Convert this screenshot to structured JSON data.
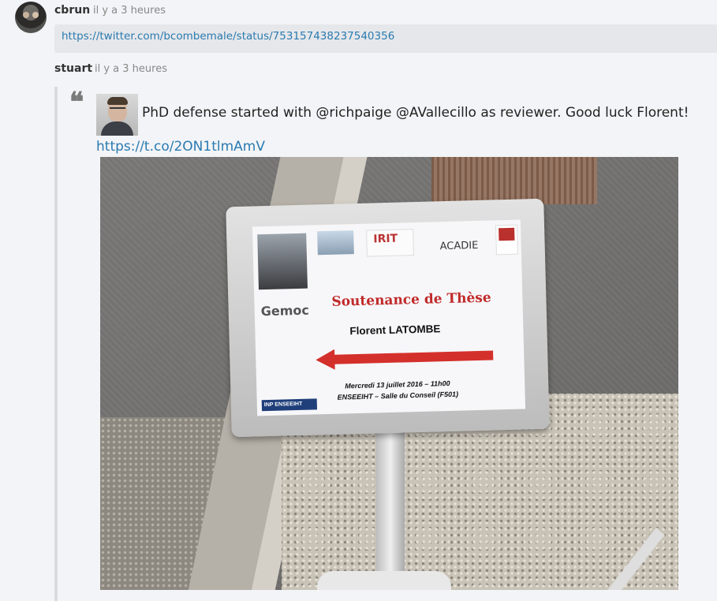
{
  "comments": [
    {
      "username": "cbrun",
      "timestamp": "il y a 3 heures",
      "link": "https://twitter.com/bcombemale/status/753157438237540356"
    },
    {
      "username": "stuart",
      "timestamp": "il y a 3 heures",
      "tweet": {
        "text": "PhD defense started with @richpaige @AVallecillo as reviewer. Good luck Florent!",
        "link": "https://t.co/2ON1tlmAmV"
      }
    }
  ],
  "photo": {
    "sign_title": "Soutenance de Thèse",
    "sign_name": "Florent LATOMBE",
    "sign_date": "Mercredi 13 juillet 2016 – 11h00",
    "sign_place": "ENSEEIHT – Salle du Conseil (F501)",
    "logo_irit": "IRIT",
    "logo_acadie": "ACADIE",
    "logo_gemoc": "Gemoc",
    "logo_inp": "INP ENSEEIHT",
    "arrow_color": "#d4302b"
  },
  "colors": {
    "link": "#2a7ab0",
    "background": "#f3f4f7",
    "link_box": "#e6e7ea"
  }
}
